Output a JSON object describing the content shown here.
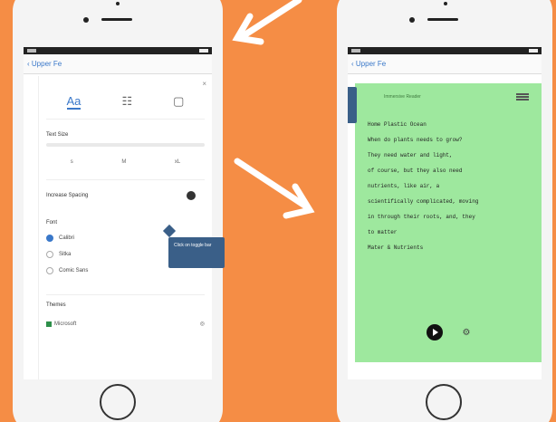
{
  "left_phone": {
    "back_label": "‹ Upper Fe",
    "tabs": [
      {
        "icon": "text-size-icon",
        "glyph": "Aa"
      },
      {
        "icon": "layout-icon",
        "glyph": "☷"
      },
      {
        "icon": "page-icon",
        "glyph": "▢"
      }
    ],
    "text_size_label": "Text Size",
    "size_marks": [
      "s",
      "M",
      "xL"
    ],
    "spacing_label": "Increase Spacing",
    "font_label": "Font",
    "fonts": [
      {
        "label": "Calibri",
        "checked": true
      },
      {
        "label": "Sitka",
        "checked": false
      },
      {
        "label": "Comic Sans",
        "checked": false
      }
    ],
    "themes_label": "Themes",
    "footer_brand": "Microsoft",
    "footer_right": "◎",
    "tooltip": "Click on toggle bar"
  },
  "right_phone": {
    "back_label": "‹ Upper Fe",
    "reader_title": "Immersive Reader",
    "poem_lines": [
      "Home Plastic Ocean",
      "When do plants needs to grow?",
      "They need water and light,",
      "of course, but they also need",
      "nutrients, like air, a",
      "scientifically complicated, moving",
      "in through their roots, and, they",
      "to matter",
      "Mater & Nutrients"
    ]
  },
  "colors": {
    "background": "#f58d45",
    "reader_bg": "#9ee89e",
    "accent": "#3a78c9"
  }
}
